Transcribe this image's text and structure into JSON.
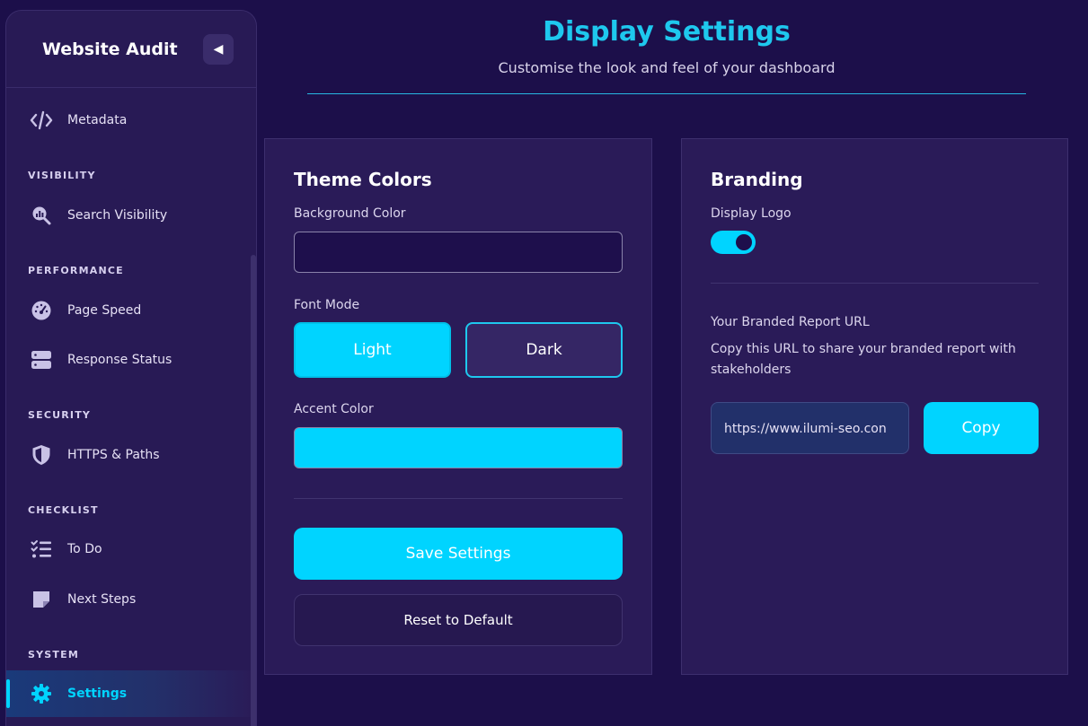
{
  "sidebar": {
    "title": "Website Audit",
    "collapse_icon": "◀",
    "items": [
      {
        "label": "Metadata",
        "icon": "code-icon"
      },
      {
        "label": "Search Visibility",
        "icon": "search-chart-icon"
      },
      {
        "label": "Page Speed",
        "icon": "speedometer-icon"
      },
      {
        "label": "Response Status",
        "icon": "server-icon"
      },
      {
        "label": "HTTPS & Paths",
        "icon": "shield-icon"
      },
      {
        "label": "To Do",
        "icon": "checklist-icon"
      },
      {
        "label": "Next Steps",
        "icon": "note-icon"
      },
      {
        "label": "Settings",
        "icon": "gear-icon",
        "active": true
      }
    ],
    "sections": {
      "visibility": "VISIBILITY",
      "performance": "PERFORMANCE",
      "security": "SECURITY",
      "checklist": "CHECKLIST",
      "system": "SYSTEM"
    }
  },
  "header": {
    "title": "Display Settings",
    "subtitle": "Customise the look and feel of your dashboard"
  },
  "theme": {
    "title": "Theme Colors",
    "background_label": "Background Color",
    "background_value": "#1e0f4c",
    "font_mode_label": "Font Mode",
    "light_label": "Light",
    "dark_label": "Dark",
    "accent_label": "Accent Color",
    "accent_value": "#00d4ff",
    "save_label": "Save Settings",
    "reset_label": "Reset to Default"
  },
  "branding": {
    "title": "Branding",
    "display_logo_label": "Display Logo",
    "display_logo_on": true,
    "url_heading": "Your Branded Report URL",
    "url_description": "Copy this URL to share your branded report with stakeholders",
    "url_value": "https://www.ilumi-seo.con",
    "copy_label": "Copy"
  },
  "colors": {
    "accent": "#00d4ff",
    "background": "#1c0f4a",
    "card": "#2a1b58"
  }
}
